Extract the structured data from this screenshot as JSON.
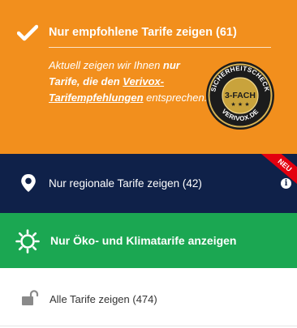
{
  "recommended": {
    "title": "Nur empfohlene Tarife zeigen (61)",
    "desc_intro": "Aktuell zeigen wir Ihnen ",
    "desc_bold1": "nur",
    "desc_bold2": "Tarife, die den ",
    "desc_link": "Verivox-Tarifempfehlungen",
    "desc_outro": "entsprechen.",
    "seal": {
      "top_text": "SICHERHEITSCHECK",
      "center_text": "3-FACH",
      "bottom_text": "VERIVOX.DE"
    }
  },
  "regional": {
    "label": "Nur regionale Tarife zeigen (42)",
    "badge": "NEU",
    "info_glyph": "i"
  },
  "eco": {
    "label": "Nur Öko- und Klimatarife anzeigen"
  },
  "all": {
    "label": "Alle Tarife zeigen (474)"
  },
  "icons": [
    "check-icon",
    "seal-badge-icon",
    "location-pin-icon",
    "info-icon",
    "sun-icon",
    "unlocked-lock-icon"
  ],
  "colors": {
    "orange": "#f28f1d",
    "navy": "#0f2149",
    "green": "#1ba752",
    "red": "#e3000f",
    "gold": "#c9a33c"
  }
}
